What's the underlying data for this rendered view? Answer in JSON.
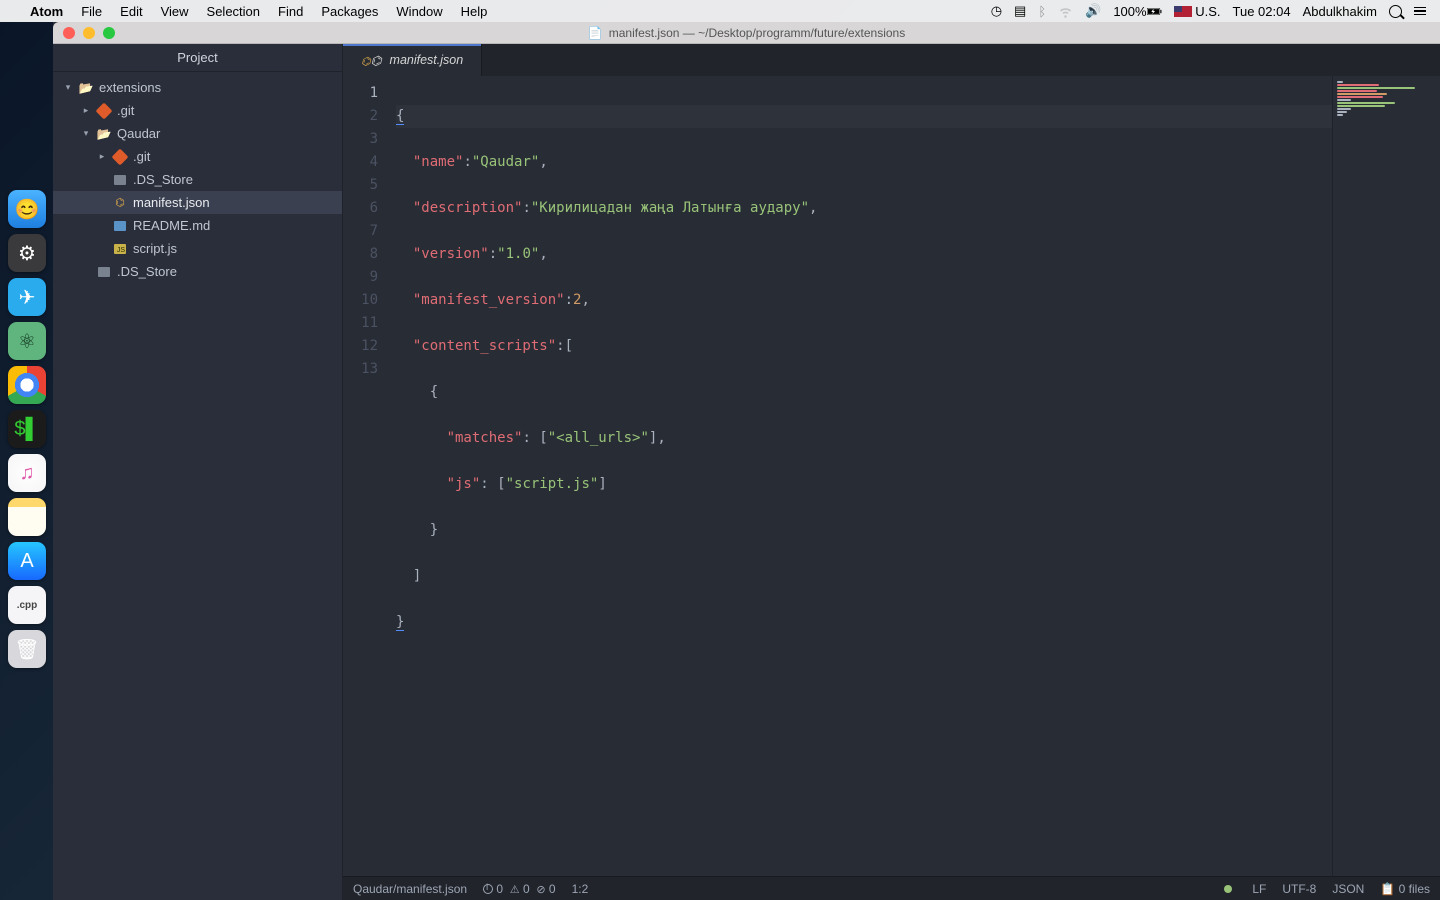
{
  "menubar": {
    "app": "Atom",
    "items": [
      "File",
      "Edit",
      "View",
      "Selection",
      "Find",
      "Packages",
      "Window",
      "Help"
    ],
    "battery": "100%",
    "input_lang": "U.S.",
    "clock": "Tue 02:04",
    "user": "Abdulkhakim"
  },
  "window": {
    "title": "manifest.json — ~/Desktop/programm/future/extensions"
  },
  "sidebar": {
    "tab": "Project",
    "tree": {
      "root": "extensions",
      "git1": ".git",
      "folder": "Qaudar",
      "git2": ".git",
      "ds1": ".DS_Store",
      "manifest": "manifest.json",
      "readme": "README.md",
      "script": "script.js",
      "ds2": ".DS_Store"
    }
  },
  "tab": {
    "label": "manifest.json"
  },
  "code": {
    "lines": 13,
    "l1": "{",
    "l2_k": "\"name\"",
    "l2_v": "\"Qaudar\"",
    "l3_k": "\"description\"",
    "l3_v": "\"Кирилицадан жаңа Латынға аудару\"",
    "l4_k": "\"version\"",
    "l4_v": "\"1.0\"",
    "l5_k": "\"manifest_version\"",
    "l5_v": "2",
    "l6_k": "\"content_scripts\"",
    "l7": "{",
    "l8_k": "\"matches\"",
    "l8_v": "\"<all_urls>\"",
    "l9_k": "\"js\"",
    "l9_v": "\"script.js\"",
    "l10": "}",
    "l11": "]",
    "l12": "}"
  },
  "status": {
    "path": "Qaudar/manifest.json",
    "info": "0",
    "warn": "0",
    "err": "0",
    "cursor": "1:2",
    "eol": "LF",
    "encoding": "UTF-8",
    "grammar": "JSON",
    "files": "0 files"
  },
  "dock": {
    "cpp": ".cpp"
  }
}
